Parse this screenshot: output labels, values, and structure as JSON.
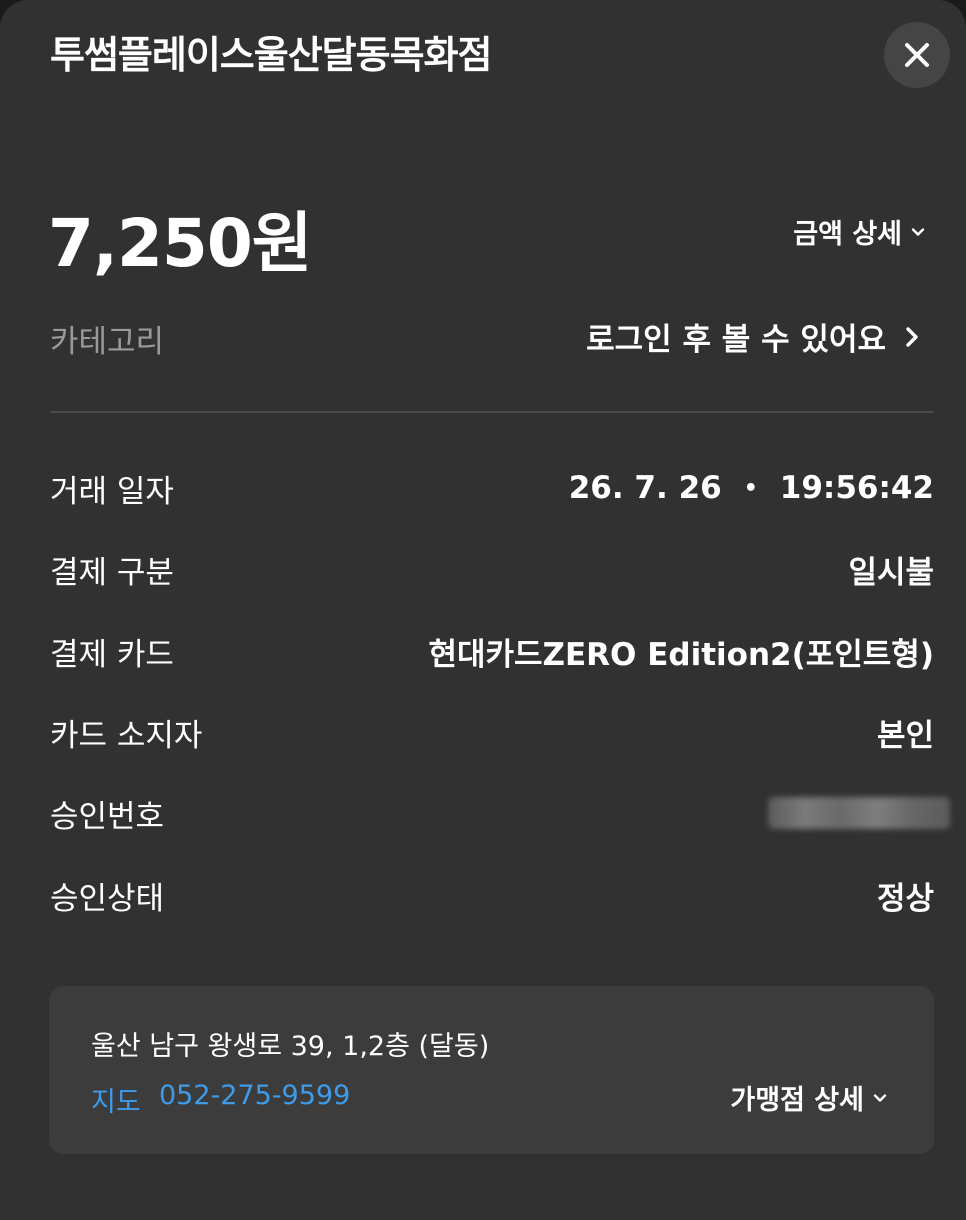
{
  "header": {
    "title": "투썸플레이스울산달동목화점",
    "close_icon": "close-icon"
  },
  "amount": {
    "value": "7,250원",
    "detail_label": "금액 상세"
  },
  "category": {
    "label": "카테고리",
    "link_text": "로그인 후 볼 수 있어요"
  },
  "details": {
    "transaction_date": {
      "label": "거래 일자",
      "date": "26. 7. 26",
      "separator": "•",
      "time": "19:56:42"
    },
    "payment_type": {
      "label": "결제 구분",
      "value": "일시불"
    },
    "payment_card": {
      "label": "결제 카드",
      "value": "현대카드ZERO Edition2(포인트형)"
    },
    "card_holder": {
      "label": "카드 소지자",
      "value": "본인"
    },
    "approval_number": {
      "label": "승인번호"
    },
    "approval_status": {
      "label": "승인상태",
      "value": "정상"
    }
  },
  "store": {
    "address": "울산 남구 왕생로 39, 1,2층 (달동)",
    "map_label": "지도",
    "phone": "052-275-9599",
    "detail_label": "가맹점 상세"
  },
  "colors": {
    "background": "#313131",
    "card_background": "#3c3c3c",
    "link_blue": "#3d9be9",
    "muted_text": "#9a9a9a"
  }
}
